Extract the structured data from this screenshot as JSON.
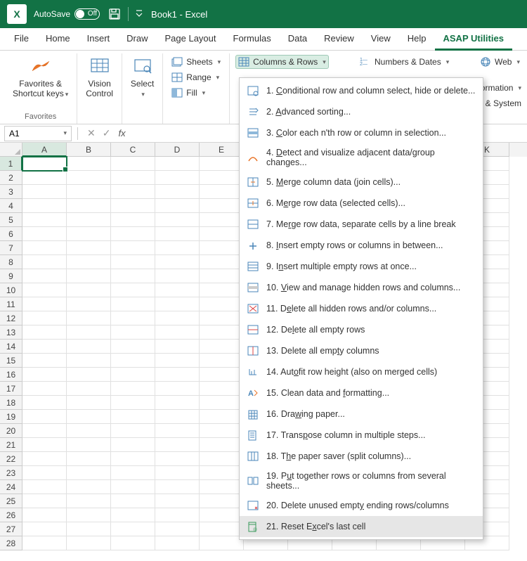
{
  "title": {
    "autosave_label": "AutoSave",
    "autosave_state": "Off",
    "doc_name": "Book1  -  Excel"
  },
  "tabs": [
    "File",
    "Home",
    "Insert",
    "Draw",
    "Page Layout",
    "Formulas",
    "Data",
    "Review",
    "View",
    "Help",
    "ASAP Utilities"
  ],
  "active_tab": 10,
  "ribbon": {
    "favorites": {
      "label": "Favorites &",
      "label2": "Shortcut keys",
      "group_label": "Favorites"
    },
    "vision": {
      "label": "Vision",
      "label2": "Control"
    },
    "select": {
      "label": "Select"
    },
    "sheets": "Sheets",
    "range": "Range",
    "fill": "Fill",
    "columns_rows": "Columns & Rows",
    "numbers_dates": "Numbers & Dates",
    "web": "Web",
    "information": "formation",
    "file_system": "le & System"
  },
  "namebox": "A1",
  "columns": [
    "A",
    "B",
    "C",
    "D",
    "E",
    "",
    "",
    "",
    "",
    "",
    "K"
  ],
  "row_count": 28,
  "menu": {
    "items": [
      {
        "n": "1.",
        "u": "C",
        "rest": "onditional row and column select, hide or delete..."
      },
      {
        "n": "2.",
        "u": "A",
        "rest": "dvanced sorting..."
      },
      {
        "n": "3.",
        "u": "C",
        "pre": "",
        "mid": "olor each n'th row or column in selection..."
      },
      {
        "n": "4.",
        "u": "D",
        "rest": "etect and visualize adjacent data/group changes..."
      },
      {
        "n": "5.",
        "u": "M",
        "rest": "erge column data (join cells)..."
      },
      {
        "n": "6.",
        "pre": "M",
        "u": "e",
        "rest": "rge row data (selected cells)..."
      },
      {
        "n": "7.",
        "pre": "Me",
        "u": "r",
        "rest": "ge row data, separate cells by a line break"
      },
      {
        "n": "8.",
        "u": "I",
        "rest": "nsert empty rows or columns in between..."
      },
      {
        "n": "9.",
        "pre": "I",
        "u": "n",
        "rest": "sert multiple empty rows at once..."
      },
      {
        "n": "10.",
        "u": "V",
        "rest": "iew and manage hidden rows and columns..."
      },
      {
        "n": "11.",
        "pre": "D",
        "u": "e",
        "rest": "lete all hidden rows and/or columns..."
      },
      {
        "n": "12.",
        "pre": "De",
        "u": "l",
        "rest": "ete all empty rows"
      },
      {
        "n": "13.",
        "pre": "Delete all emp",
        "u": "t",
        "rest": "y columns"
      },
      {
        "n": "14.",
        "pre": "Aut",
        "u": "o",
        "rest": "fit row height (also on merged cells)"
      },
      {
        "n": "15.",
        "pre": "Clean data and ",
        "u": "f",
        "rest": "ormatting..."
      },
      {
        "n": "16.",
        "pre": "Dra",
        "u": "w",
        "rest": "ing paper..."
      },
      {
        "n": "17.",
        "pre": "Trans",
        "u": "p",
        "rest": "ose column in multiple steps..."
      },
      {
        "n": "18.",
        "pre": "T",
        "u": "h",
        "rest": "e paper saver (split columns)..."
      },
      {
        "n": "19.",
        "pre": "P",
        "u": "u",
        "rest": "t together rows or columns from several sheets..."
      },
      {
        "n": "20.",
        "pre": "Delete unused empt",
        "u": "y",
        "rest": " ending rows/columns"
      },
      {
        "n": "21.",
        "pre": "Reset E",
        "u": "x",
        "rest": "cel's last cell"
      }
    ],
    "hover_index": 20
  }
}
